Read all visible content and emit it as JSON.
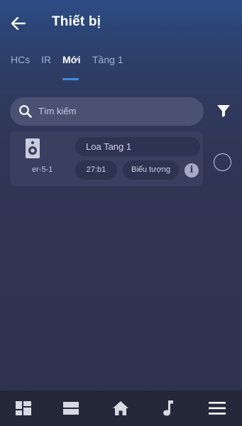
{
  "header": {
    "title": "Thiết bị",
    "back_icon": "arrow-left-icon"
  },
  "tabs": [
    {
      "label": "HCs",
      "active": false
    },
    {
      "label": "IR",
      "active": false
    },
    {
      "label": "Mới",
      "active": true
    },
    {
      "label": "Tầng 1",
      "active": false
    }
  ],
  "search": {
    "placeholder": "Tìm kiếm",
    "icon": "search-icon"
  },
  "filter": {
    "icon": "filter-icon"
  },
  "devices": [
    {
      "icon": "speaker-icon",
      "code": "er-5-1",
      "name": "Loa Tang 1",
      "address": "27:b1",
      "icon_button_label": "Biểu tượng",
      "info_label": "i",
      "selected": false
    }
  ],
  "bottom_nav": [
    {
      "icon": "dashboard-icon"
    },
    {
      "icon": "rooms-icon"
    },
    {
      "icon": "home-icon"
    },
    {
      "icon": "music-note-icon"
    },
    {
      "icon": "menu-icon"
    }
  ],
  "colors": {
    "accent": "#3d8de8",
    "header_bg": "#2d4f86",
    "body_bg": "#303350",
    "card_bg": "#3a3f60",
    "pill_bg": "#2e3352",
    "nav_bg": "#252838"
  }
}
